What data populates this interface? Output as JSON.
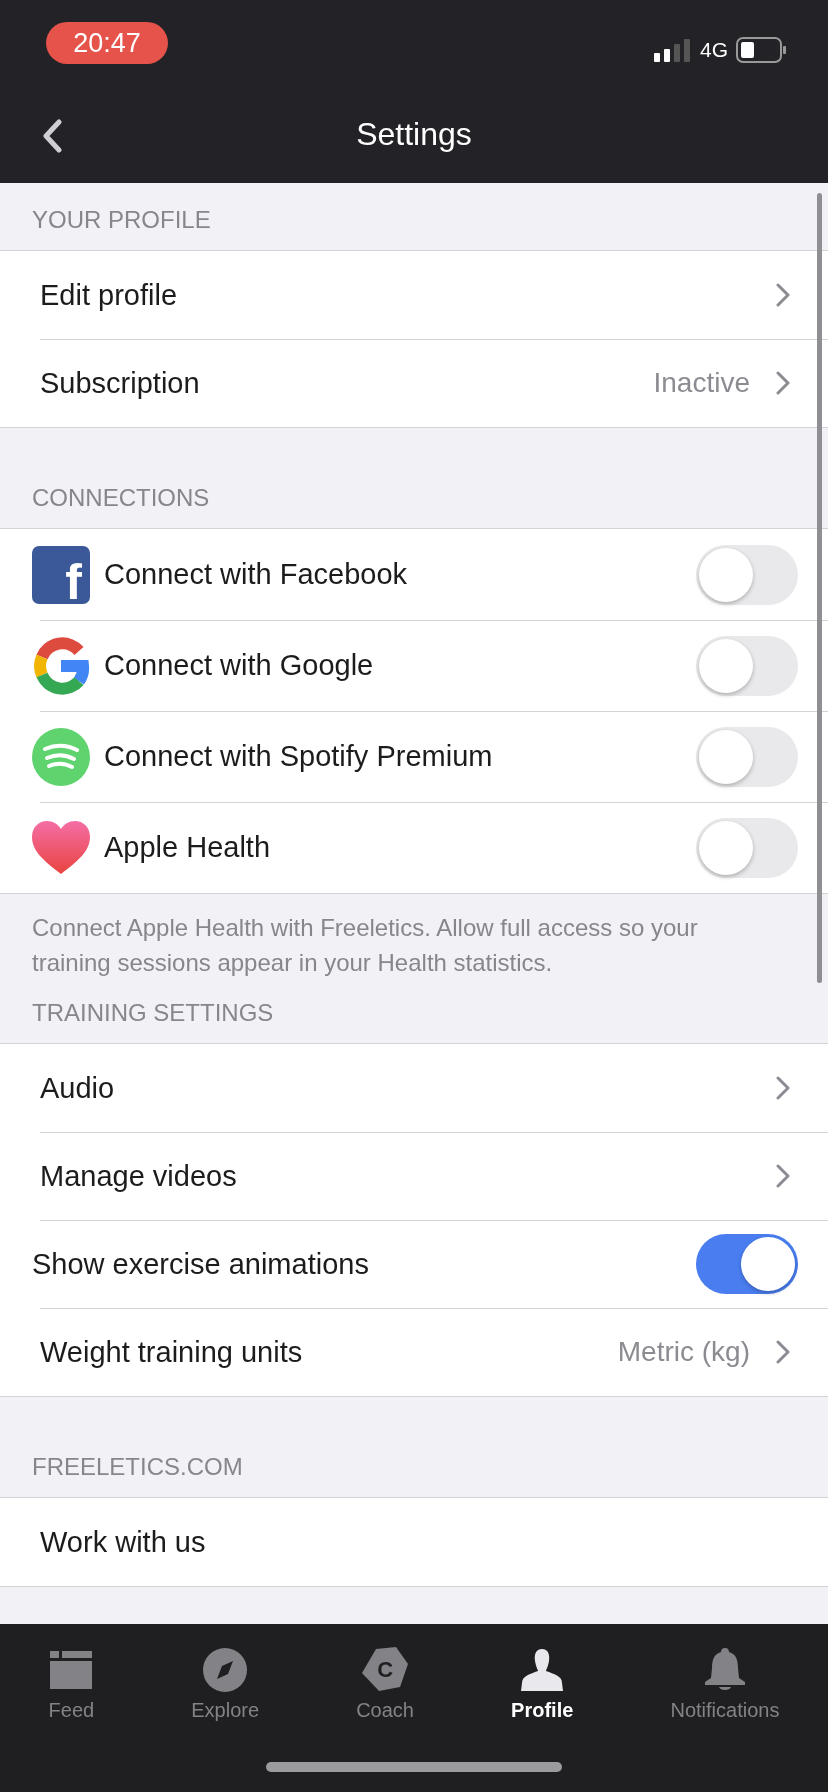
{
  "status_bar": {
    "time": "20:47",
    "network": "4G"
  },
  "nav_bar": {
    "title": "Settings"
  },
  "sections": [
    {
      "header": "YOUR PROFILE",
      "rows": [
        {
          "kind": "link",
          "label": "Edit profile"
        },
        {
          "kind": "link",
          "label": "Subscription",
          "value": "Inactive"
        }
      ]
    },
    {
      "header": "CONNECTIONS",
      "footer": "Connect Apple Health with Freeletics. Allow full access so your training sessions appear in your Health statistics.",
      "rows": [
        {
          "kind": "connection",
          "glyph": "f",
          "label": "Connect with Facebook",
          "on": false
        },
        {
          "kind": "connection",
          "label": "Connect with Google",
          "on": false
        },
        {
          "kind": "connection",
          "label": "Connect with Spotify Premium",
          "on": false
        },
        {
          "kind": "connection",
          "label": "Apple Health",
          "on": false
        }
      ]
    },
    {
      "header": "TRAINING SETTINGS",
      "rows": [
        {
          "kind": "link",
          "label": "Audio"
        },
        {
          "kind": "link",
          "label": "Manage videos"
        },
        {
          "kind": "toggle",
          "label": "Show exercise animations",
          "on": true
        },
        {
          "kind": "link",
          "label": "Weight training units",
          "value": "Metric (kg)"
        }
      ]
    },
    {
      "header": "FREELETICS.COM",
      "rows": [
        {
          "kind": "plain",
          "label": "Work with us"
        }
      ]
    }
  ],
  "tabs": [
    {
      "label": "Feed",
      "selected": false
    },
    {
      "label": "Explore",
      "selected": false
    },
    {
      "label": "Coach",
      "glyph": "C",
      "selected": false
    },
    {
      "label": "Profile",
      "selected": true
    },
    {
      "label": "Notifications",
      "selected": false
    }
  ]
}
